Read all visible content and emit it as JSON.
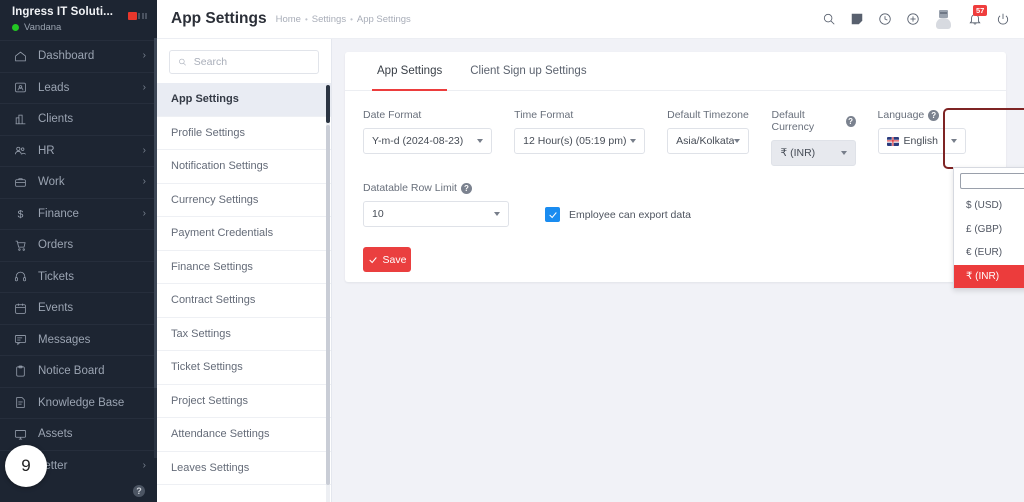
{
  "sidebar": {
    "company": "Ingress IT Soluti...",
    "user": "Vandana",
    "items": [
      {
        "label": "Dashboard",
        "icon": "home-icon",
        "chevron": "›"
      },
      {
        "label": "Leads",
        "icon": "leads-icon",
        "chevron": "›"
      },
      {
        "label": "Clients",
        "icon": "clients-icon",
        "chevron": ""
      },
      {
        "label": "HR",
        "icon": "hr-icon",
        "chevron": "›"
      },
      {
        "label": "Work",
        "icon": "work-icon",
        "chevron": "›"
      },
      {
        "label": "Finance",
        "icon": "finance-icon",
        "chevron": "›"
      },
      {
        "label": "Orders",
        "icon": "orders-icon",
        "chevron": ""
      },
      {
        "label": "Tickets",
        "icon": "tickets-icon",
        "chevron": ""
      },
      {
        "label": "Events",
        "icon": "events-icon",
        "chevron": ""
      },
      {
        "label": "Messages",
        "icon": "messages-icon",
        "chevron": ""
      },
      {
        "label": "Notice Board",
        "icon": "notice-board-icon",
        "chevron": ""
      },
      {
        "label": "Knowledge Base",
        "icon": "knowledge-base-icon",
        "chevron": ""
      },
      {
        "label": "Assets",
        "icon": "assets-icon",
        "chevron": ""
      },
      {
        "label": "Letter",
        "icon": "letter-icon",
        "chevron": "›"
      }
    ],
    "help_glyph": "?"
  },
  "overlay": {
    "step_number": "9"
  },
  "header": {
    "title": "App Settings",
    "breadcrumb": [
      "Home",
      "Settings",
      "App Settings"
    ],
    "separator": "•",
    "icons": [
      {
        "name": "search-icon"
      },
      {
        "name": "note-icon"
      },
      {
        "name": "clock-icon"
      },
      {
        "name": "plus-circle-icon"
      },
      {
        "name": "avatar"
      },
      {
        "name": "bell-icon"
      },
      {
        "name": "power-icon"
      }
    ],
    "notification_count": "57"
  },
  "settings_nav": {
    "search_placeholder": "Search",
    "search_value": "",
    "items": [
      "App Settings",
      "Profile Settings",
      "Notification Settings",
      "Currency Settings",
      "Payment Credentials",
      "Finance Settings",
      "Contract Settings",
      "Tax Settings",
      "Ticket Settings",
      "Project Settings",
      "Attendance Settings",
      "Leaves Settings"
    ],
    "active": "App Settings"
  },
  "content": {
    "tabs": [
      {
        "label": "App Settings",
        "active": true
      },
      {
        "label": "Client Sign up Settings",
        "active": false
      }
    ],
    "fields": {
      "date_format": {
        "label": "Date Format",
        "value": "Y-m-d (2024-08-23)"
      },
      "time_format": {
        "label": "Time Format",
        "value": "12 Hour(s) (05:19 pm)"
      },
      "default_timezone": {
        "label": "Default Timezone",
        "value": "Asia/Kolkata"
      },
      "default_currency": {
        "label": "Default Currency",
        "value": "₹ (INR)",
        "help": "?"
      },
      "language": {
        "label": "Language",
        "value": "English",
        "help": "?"
      },
      "datatable_row_limit": {
        "label": "Datatable Row Limit",
        "value": "10",
        "help": "?"
      },
      "export_checkbox": {
        "label": "Employee can export data",
        "checked": true
      }
    },
    "save_label": "Save"
  },
  "currency_dropdown": {
    "search_value": "",
    "options": [
      {
        "label": "$ (USD)",
        "selected": false
      },
      {
        "label": "£ (GBP)",
        "selected": false
      },
      {
        "label": "€ (EUR)",
        "selected": false
      },
      {
        "label": "₹ (INR)",
        "selected": true
      }
    ]
  },
  "colors": {
    "sidebar_bg": "#1d2532",
    "accent_red": "#ec3c3c",
    "highlight_border": "#7e2424",
    "cursor": "#f47d32",
    "page_bg": "#f1f2f7",
    "checkbox_blue": "#1a8cf0"
  }
}
